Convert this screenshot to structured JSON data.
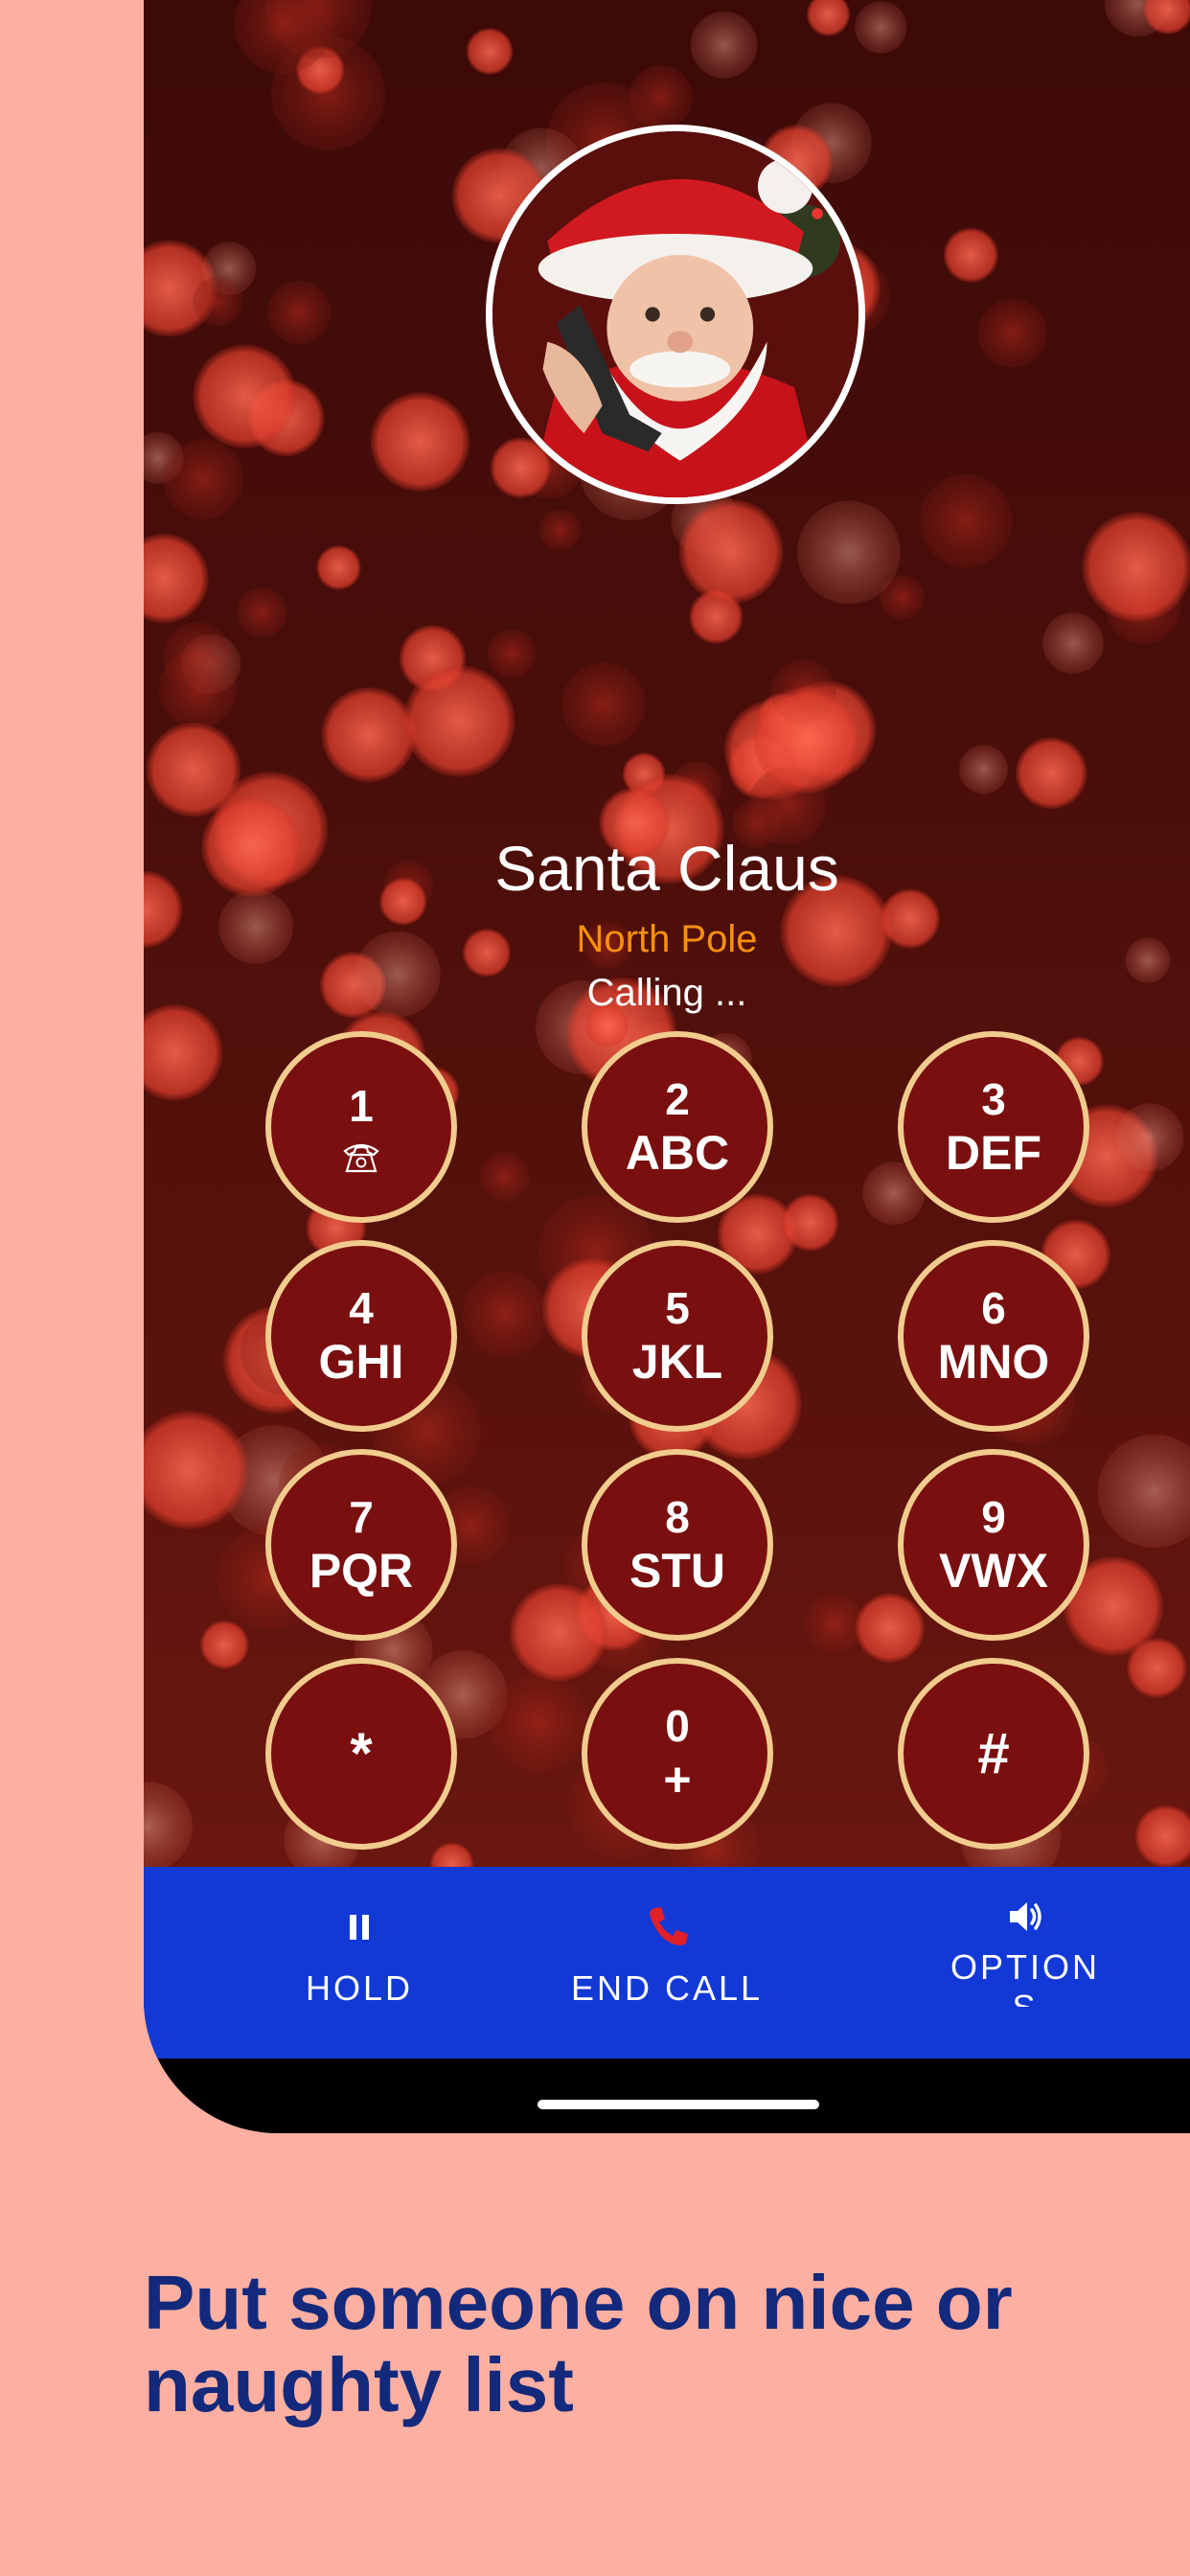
{
  "caller": {
    "name": "Santa Claus",
    "location": "North Pole",
    "status": "Calling ..."
  },
  "keypad": [
    {
      "digit": "1",
      "letters": "",
      "icon": "phone-icon"
    },
    {
      "digit": "2",
      "letters": "ABC"
    },
    {
      "digit": "3",
      "letters": "DEF"
    },
    {
      "digit": "4",
      "letters": "GHI"
    },
    {
      "digit": "5",
      "letters": "JKL"
    },
    {
      "digit": "6",
      "letters": "MNO"
    },
    {
      "digit": "7",
      "letters": "PQR"
    },
    {
      "digit": "8",
      "letters": "STU"
    },
    {
      "digit": "9",
      "letters": "VWX"
    },
    {
      "symbol": "*"
    },
    {
      "digit": "0",
      "letters": "+"
    },
    {
      "symbol": "#"
    }
  ],
  "actions": {
    "hold": {
      "label": "HOLD",
      "icon": "pause-icon"
    },
    "end_call": {
      "label": "END CALL",
      "icon": "end-call-icon"
    },
    "options": {
      "label_line1": "OPTION",
      "label_line2": "S",
      "icon": "speaker-icon"
    }
  },
  "headline": {
    "line1": "Put someone on nice or",
    "line2": "naughty list"
  },
  "colors": {
    "background": "#fdafa2",
    "screen_bg": "#4a0e0a",
    "key_fill": "#7a0f10",
    "key_border": "#f1cc8e",
    "location": "#f6900c",
    "action_bar": "#1239d6",
    "end_call_icon": "#e0202a",
    "headline": "#13297c"
  }
}
